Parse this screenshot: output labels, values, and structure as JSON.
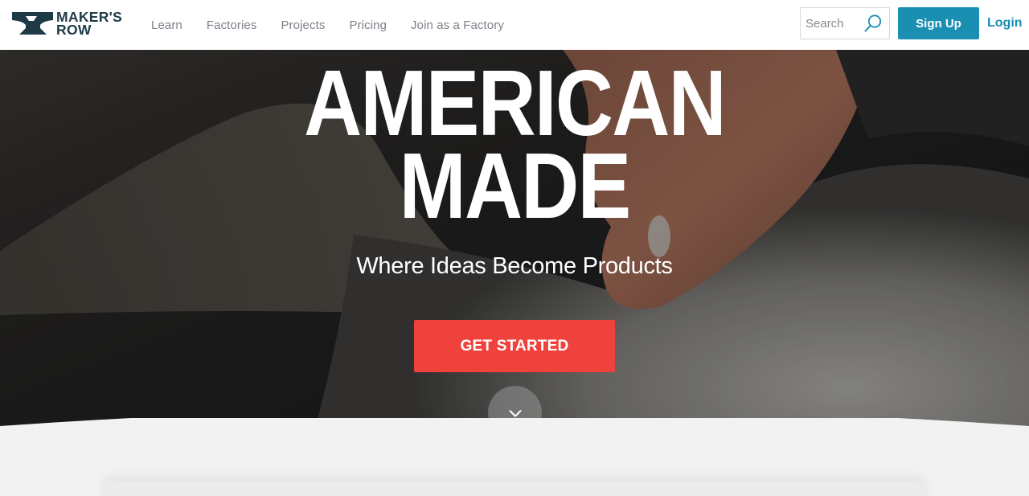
{
  "brand": {
    "name_line1": "MAKER'S",
    "name_line2": "ROW"
  },
  "nav": {
    "items": [
      {
        "label": "Learn"
      },
      {
        "label": "Factories"
      },
      {
        "label": "Projects"
      },
      {
        "label": "Pricing"
      },
      {
        "label": "Join as a Factory"
      }
    ]
  },
  "search": {
    "placeholder": "Search",
    "icon": "search-icon"
  },
  "auth": {
    "signup_label": "Sign Up",
    "login_label": "Login"
  },
  "hero": {
    "headline_line1": "AMERICAN",
    "headline_line2": "MADE",
    "tagline": "Where Ideas Become Products",
    "cta_label": "GET STARTED",
    "scroll_icon": "chevron-down-icon"
  },
  "colors": {
    "brand_dark": "#1e3a47",
    "accent_blue": "#1b8fb2",
    "cta_red": "#ef423d",
    "nav_text": "#7c8088"
  }
}
